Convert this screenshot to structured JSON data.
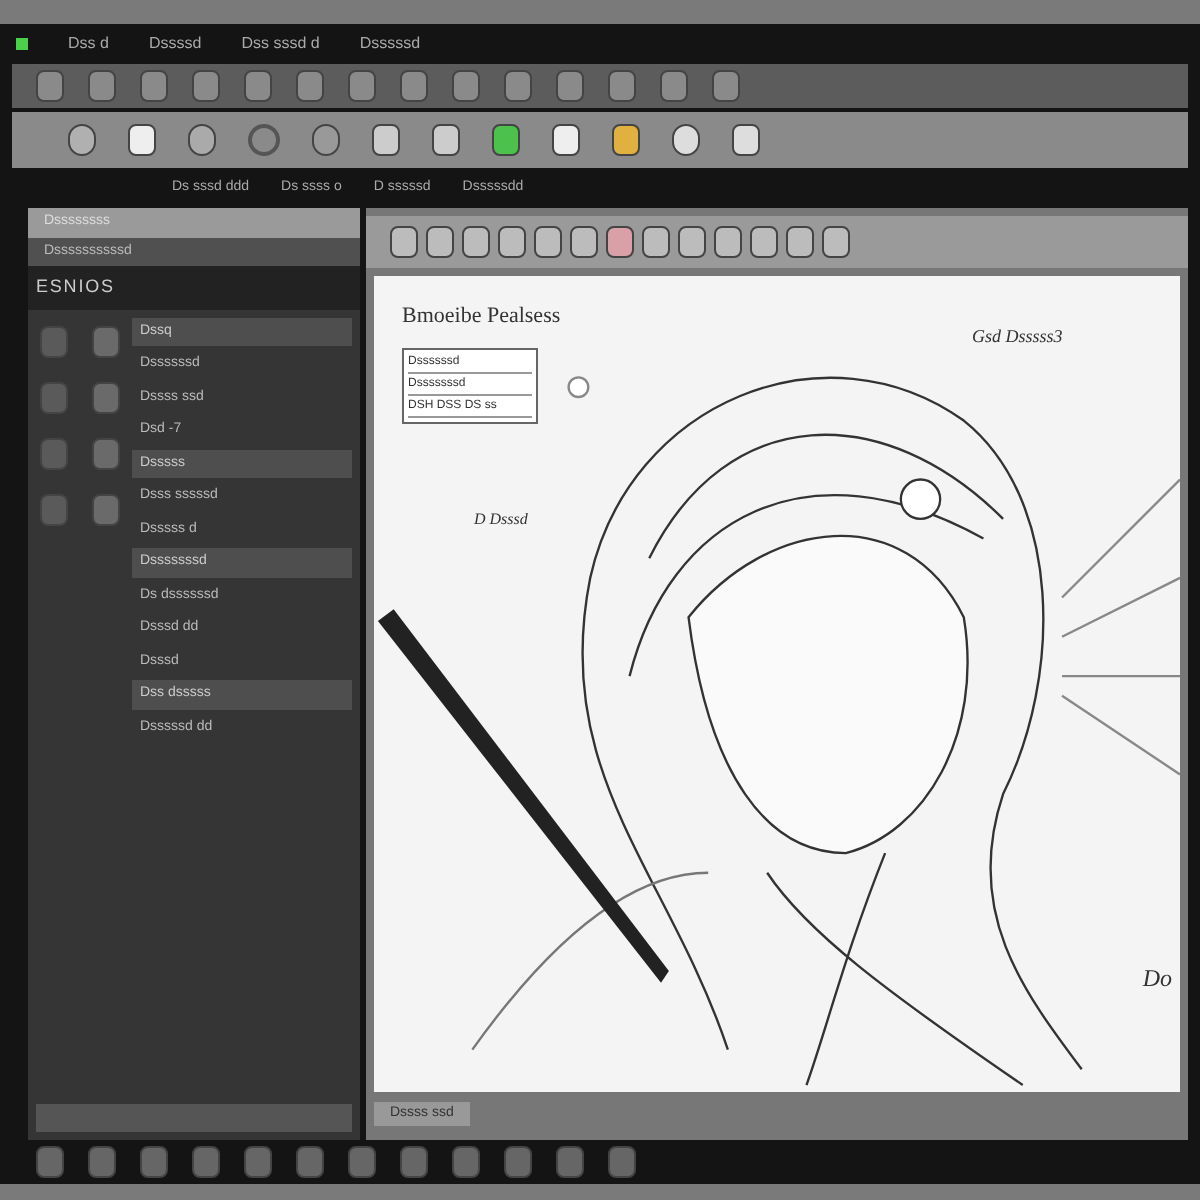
{
  "menu_bar": [
    "Dss d",
    "Dssssd",
    "Dss sssd d",
    "Dsssssd"
  ],
  "info_bar": [
    "Ds sssd ddd",
    "Ds ssss o",
    "D sssssd",
    "Dsssssdd"
  ],
  "panel": {
    "header": "Dssssssss",
    "subheader": "Dssssssssssd",
    "title": "ESNIOS",
    "rows": [
      {
        "kind": "section",
        "label": "Dssq"
      },
      {
        "kind": "item",
        "label": "Dssssssd"
      },
      {
        "kind": "item",
        "label": "Dssss ssd"
      },
      {
        "kind": "item",
        "label": "Dsd -7"
      },
      {
        "kind": "section",
        "label": "Dsssss"
      },
      {
        "kind": "item",
        "label": "Dsss sssssd"
      },
      {
        "kind": "item",
        "label": "Dsssss d"
      },
      {
        "kind": "section",
        "label": "Dsssssssd"
      },
      {
        "kind": "item",
        "label": "Ds dssssssd"
      },
      {
        "kind": "item",
        "label": "Dsssd dd"
      },
      {
        "kind": "item",
        "label": "Dsssd"
      },
      {
        "kind": "section",
        "label": "Dss dsssss"
      },
      {
        "kind": "item",
        "label": "Dsssssd dd"
      }
    ]
  },
  "canvas": {
    "title": "Bmoeibe Pealsess",
    "note_box": [
      "Dssssssd",
      "Dsssssssd",
      "DSH DSS DS ss"
    ],
    "annotation_left": "D Dsssd",
    "annotation_right": "Gsd Dsssss3",
    "annotation_corner": "Do",
    "status": "Dssss ssd"
  }
}
